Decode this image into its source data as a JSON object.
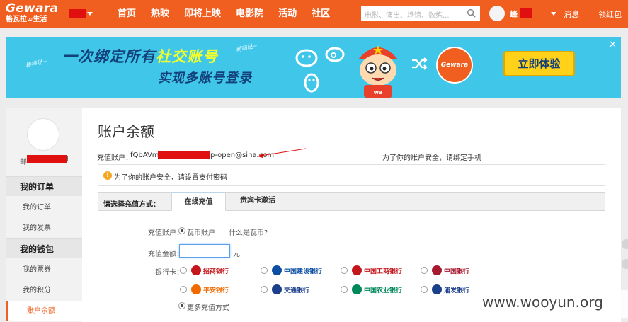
{
  "header": {
    "logo_en": "Gewara",
    "logo_cn": "格瓦拉∞生活",
    "nav": [
      "首页",
      "热映",
      "即将上映",
      "电影院",
      "活动",
      "社区"
    ],
    "search_placeholder": "电影、演出、场馆、数练...",
    "user_initial": "峰",
    "messages": "消息",
    "coupon": "领红包"
  },
  "banner": {
    "line1_a": "一次绑定所有",
    "line1_b": "社交账号",
    "line2": "实现多账号登录",
    "hint1": "棒棒哒~",
    "hint2": "萌萌哒~",
    "logo": "Gewara",
    "cta": "立即体验",
    "close": "✕"
  },
  "sidebar": {
    "email_prefix": "邮",
    "email_suffix": "l",
    "sections": [
      {
        "title": "我的订单",
        "items": [
          "我的订单",
          "我的发票"
        ]
      },
      {
        "title": "我的钱包",
        "items": [
          "我的票券",
          "我的积分",
          "账户余额"
        ]
      }
    ],
    "active_item": "账户余额"
  },
  "main": {
    "title": "账户余额",
    "account_label": "充值账户：",
    "account_value_start": "fQbAVm",
    "account_value_end": "p-open@sina.com",
    "phone_note_a": "为了你的账户安全，请",
    "phone_note_b": "绑定手机",
    "notice_a": "为了你的账户安全，请",
    "notice_b": "设置支付密码",
    "pay_method_label": "请选择充值方式：",
    "tabs": [
      "在线充值",
      "贵宾卡激活"
    ],
    "form": {
      "account_label": "充值账户：",
      "account_option": "瓦币账户",
      "what_is": "什么是瓦币?",
      "amount_label": "充值金额：",
      "amount_value": "",
      "amount_unit": "元",
      "bank_label": "银行卡：",
      "banks": [
        {
          "name": "招商银行",
          "color": "#c4161c"
        },
        {
          "name": "中国建设银行",
          "color": "#0b4ea2"
        },
        {
          "name": "中国工商银行",
          "color": "#c4161c"
        },
        {
          "name": "中国银行",
          "color": "#a6192e"
        },
        {
          "name": "平安银行",
          "color": "#f06a00"
        },
        {
          "name": "交通银行",
          "color": "#1b3f8b"
        },
        {
          "name": "中国农业银行",
          "color": "#00875a"
        },
        {
          "name": "浦发银行",
          "color": "#1b3f8b"
        }
      ],
      "more": "更多充值方式"
    }
  },
  "watermark": "www.wooyun.org"
}
